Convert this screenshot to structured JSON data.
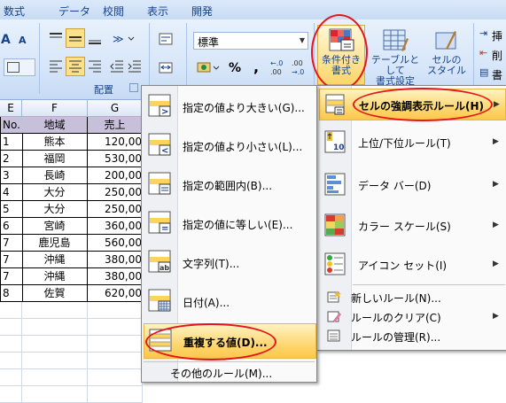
{
  "tabs": [
    "数式",
    "データ",
    "校閲",
    "表示",
    "開発"
  ],
  "ribbon": {
    "group_label": "配置",
    "font_size_up": "A",
    "font_size_down": "A",
    "number_format": "標準",
    "percent": "%",
    "comma": ",",
    "decimal_inc": "+.0\n.00",
    "decimal_dec": ".00\n→.0",
    "conditional_format": "条件付き\n書式",
    "table_format": "テーブルとして\n書式設定",
    "cell_style": "セルの\nスタイル",
    "insert": "挿",
    "delete": "削",
    "format": "書"
  },
  "sheet": {
    "col_headers": [
      "E",
      "F",
      "G"
    ],
    "header_row": [
      "No.",
      "地域",
      "売上"
    ],
    "rows": [
      [
        "1",
        "熊本",
        "120,00"
      ],
      [
        "2",
        "福岡",
        "530,00"
      ],
      [
        "3",
        "長崎",
        "200,00"
      ],
      [
        "4",
        "大分",
        "250,00"
      ],
      [
        "5",
        "大分",
        "250,00"
      ],
      [
        "6",
        "宮崎",
        "360,00"
      ],
      [
        "7",
        "鹿児島",
        "560,00"
      ],
      [
        "7",
        "沖縄",
        "380,00"
      ],
      [
        "7",
        "沖縄",
        "380,00"
      ],
      [
        "8",
        "佐賀",
        "620,00"
      ]
    ]
  },
  "main_menu": {
    "items": [
      {
        "label": "セルの強調表示ルール(H)",
        "icon": "highlight-rules-icon"
      },
      {
        "label": "上位/下位ルール(T)",
        "icon": "top-bottom-icon"
      },
      {
        "label": "データ バー(D)",
        "icon": "data-bar-icon"
      },
      {
        "label": "カラー スケール(S)",
        "icon": "color-scale-icon"
      },
      {
        "label": "アイコン セット(I)",
        "icon": "icon-set-icon"
      }
    ],
    "small_items": [
      {
        "label": "新しいルール(N)...",
        "icon": "new-rule-icon"
      },
      {
        "label": "ルールのクリア(C)",
        "icon": "clear-rules-icon"
      },
      {
        "label": "ルールの管理(R)...",
        "icon": "manage-rules-icon"
      }
    ]
  },
  "sub_menu": {
    "items": [
      {
        "label": "指定の値より大きい(G)...",
        "icon": "greater-than-icon"
      },
      {
        "label": "指定の値より小さい(L)...",
        "icon": "less-than-icon"
      },
      {
        "label": "指定の範囲内(B)...",
        "icon": "between-icon"
      },
      {
        "label": "指定の値に等しい(E)...",
        "icon": "equal-to-icon"
      },
      {
        "label": "文字列(T)...",
        "icon": "text-contains-icon"
      },
      {
        "label": "日付(A)...",
        "icon": "date-occurring-icon"
      },
      {
        "label": "重複する値(D)...",
        "icon": "duplicate-values-icon"
      }
    ],
    "other_rules": "その他のルール(M)..."
  },
  "colors": {
    "highlight": "#fcc84a",
    "annotation": "#e8141b",
    "ribbon_text": "#15428b"
  }
}
